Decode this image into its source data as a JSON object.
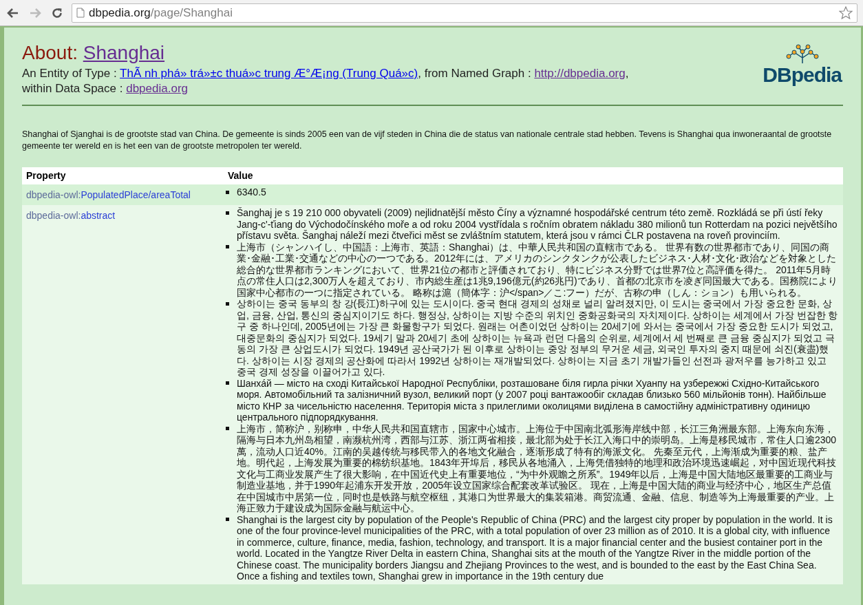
{
  "browser": {
    "back_disabled": false,
    "forward_disabled": true,
    "url_host": "dbpedia.org",
    "url_path": "/page/Shanghai",
    "bookmarked": false
  },
  "header": {
    "title_prefix": "About:",
    "title_link": "Shanghai",
    "type_label": "An Entity of Type :",
    "type_link": "ThÃ nh phá» trá»±c thuá»c trung Æ°Æ¡ng (Trung Quá»c)",
    "graph_label": ", from Named Graph :",
    "graph_link": "http://dbpedia.org",
    "graph_suffix": ",",
    "space_label": "within Data Space :",
    "space_link": "dbpedia.org",
    "logo_text": "DBpedia"
  },
  "summary": "Shanghai of Sjanghai is de grootste stad van China. De gemeente is sinds 2005 een van de vijf steden in China die de status van nationale centrale stad hebben. Tevens is Shanghai qua inwoneraantal de grootste gemeente ter wereld en is het een van de grootste metropolen ter wereld.",
  "table": {
    "columns": [
      "Property",
      "Value"
    ],
    "rows": [
      {
        "prefix": "dbpedia-owl:",
        "property": "PopulatedPlace/areaTotal",
        "values": [
          "6340.5"
        ]
      },
      {
        "prefix": "dbpedia-owl:",
        "property": "abstract",
        "values": [
          "Šanghaj je s 19 210 000 obyvateli (2009) nejlidnatější město Číny a významné hospodářské centrum této země. Rozkládá se při ústí řeky Jang-c'-ťiang do Východočínského moře a od roku 2004 vystřídala s ročním obratem nákladu 380 milionů tun Rotterdam na pozici největšího přístavu světa. Šanghaj náleží mezi čtveřici měst se zvláštním statutem, která jsou v rámci ČLR postavena na roveň provinciím.",
          "上海市（シャンハイし、中国語：上海市、英語：Shanghai）は、中華人民共和国の直轄市である。 世界有数の世界都市であり、同国の商業･金融･工業･交通などの中心の一つである。2012年には、アメリカのシンクタンクが公表したビジネス･人材･文化･政治などを対象とした総合的な世界都市ランキングにおいて、世界21位の都市と評価されており、特にビジネス分野では世界7位と高評価を得た。 2011年5月時点の常住人口は2,300万人を超えており、市内総生産は1兆9,196億元(約26兆円)であり、首都の北京市を凌ぎ同国最大である。国務院により国家中心都市の一つに指定されている。 略称は滬（簡体字：沪</span>／こ:フー）だが、古称の申（しん：ション）も用いられる。",
          "상하이는 중국 동부의 창 강(長江)하구에 있는 도시이다. 중국 현대 경제의 성채로 널리 알려졌지만, 이 도시는 중국에서 가장 중요한 문화, 상업, 금융, 산업, 통신의 중심지이기도 하다. 행정상, 상하이는 지방 수준의 위치인 중화공화국의 자치제이다. 상하이는 세계에서 가장 번잡한 항구 중 하나인데, 2005년에는 가장 큰 화물항구가 되었다. 원래는 어촌이었던 상하이는 20세기에 와서는 중국에서 가장 중요한 도시가 되었고, 대중문화의 중심지가 되었다. 19세기 말과 20세기 초에 상하이는 뉴욕과 런던 다음의 순위로, 세계에서 세 번째로 큰 금융 중심지가 되었고 극동의 가장 큰 상업도시가 되었다. 1949년 공산국가가 된 이후로 상하이는 중앙 정부의 무거운 세금, 외국인 투자의 중지 때문에 쇠진(衰盡)했다. 상하이는 시장 경제의 공산화에 따라서 1992년 상하이는 재개발되었다. 상하이는 지금 초기 개발가들인 선전과 광저우를 능가하고 있고 중국 경제 성장을 이끌어가고 있다.",
          "Шанха́й — місто на сході Китайської Народної Республіки, розташоване біля гирла річки Хуанпу на узбережжі Східно-Китайського моря. Автомобільний та залізничний вузол, великий порт (у 2007 році вантажообіг складав близько 560 мільйонів тонн). Найбільше місто КНР за чисельністю населення. Територія міста з прилеглими околицями виділена в самостійну адміністративну одиницю центрального підпорядкування.",
          "上海市，简称沪，别称申，中华人民共和国直辖市，国家中心城市。上海位于中国南北弧形海岸线中部，长江三角洲最东部。上海东向东海，隔海与日本九州岛相望，南濒杭州湾，西部与江苏、浙江两省相接，最北部为处于长江入海口中的崇明岛。上海是移民城市，常住人口逾2300萬，流动人口近40%。江南的吴越传统与移民带入的各地文化融合，逐渐形成了特有的海派文化。 先秦至元代，上海渐成为重要的粮、盐产地。明代起，上海发展为重要的棉纺织基地。1843年开埠后，移民从各地涌入，上海凭借独特的地理和政治环境迅速崛起，对中国近现代科技文化与工商业发展产生了很大影响，在中国近代史上有重要地位，“为中外观瞻之所系”。1949年以后，上海是中国大陆地区最重要的工商业与制造业基地，并于1990年起浦东开发开放，2005年设立国家综合配套改革试验区。 现在，上海是中国大陆的商业与经济中心，地区生产总值在中国城市中居第一位，同时也是铁路与航空枢纽，其港口为世界最大的集装箱港。商贸流通、金融、信息、制造等为上海最重要的产业。上海正致力于建设成为国际金融与航运中心。",
          "Shanghai is the largest city by population of the People's Republic of China (PRC) and the largest city proper by population in the world. It is one of the four province-level municipalities of the PRC, with a total population of over 23 million as of 2010. It is a global city, with influence in commerce, culture, finance, media, fashion, technology, and transport. It is a major financial center and the busiest container port in the world. Located in the Yangtze River Delta in eastern China, Shanghai sits at the mouth of the Yangtze River in the middle portion of the Chinese coast. The municipality borders Jiangsu and Zhejiang Provinces to the west, and is bounded to the east by the East China Sea. Once a fishing and textiles town, Shanghai grew in importance in the 19th century due"
        ]
      }
    ]
  }
}
